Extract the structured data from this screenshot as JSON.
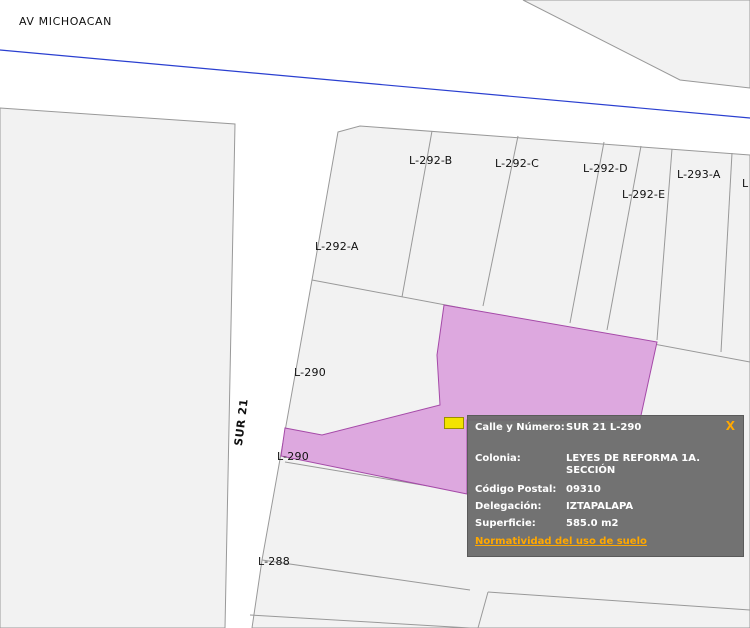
{
  "map": {
    "street_michoacan": "AV MICHOACAN",
    "street_sur21": "SUR 21",
    "lots": {
      "l292b": "L-292-B",
      "l292c": "L-292-C",
      "l292d": "L-292-D",
      "l293a": "L-293-A",
      "l292e": "L-292-E",
      "l292a": "L-292-A",
      "l290_top": "L-290",
      "l290_bottom": "L-290",
      "l288": "L-288",
      "partial": "L"
    },
    "highlight_color": "#dda8df",
    "road_line_color": "#2a3fd0"
  },
  "popup": {
    "close_label": "X",
    "rows": [
      {
        "key": "Calle y Número:",
        "value": "SUR 21 L-290"
      },
      {
        "key": "Colonia:",
        "value": "LEYES DE REFORMA 1A. SECCIÓN"
      },
      {
        "key": "Código Postal:",
        "value": "09310"
      },
      {
        "key": "Delegación:",
        "value": "IZTAPALAPA"
      },
      {
        "key": "Superficie:",
        "value": "585.0 m2"
      }
    ],
    "link_label": "Normatividad del uso de suelo",
    "accent_color": "#ffa800"
  }
}
